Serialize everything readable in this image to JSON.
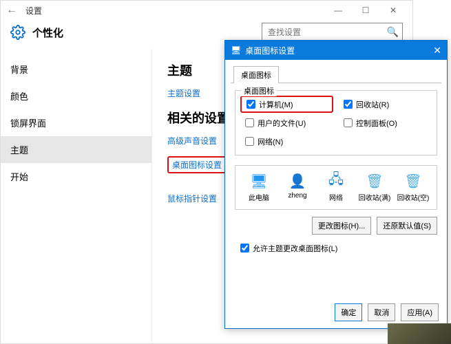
{
  "window": {
    "title": "设置"
  },
  "header": {
    "title": "个性化"
  },
  "search": {
    "placeholder": "查找设置"
  },
  "sidebar": {
    "items": [
      {
        "label": "背景"
      },
      {
        "label": "颜色"
      },
      {
        "label": "锁屏界面"
      },
      {
        "label": "主题"
      },
      {
        "label": "开始"
      }
    ],
    "selected_index": 3
  },
  "main": {
    "heading1": "主题",
    "link_theme_settings": "主题设置",
    "heading2": "相关的设置",
    "link_sound": "高级声音设置",
    "link_desktop_icons": "桌面图标设置",
    "link_mouse": "鼠标指针设置"
  },
  "dialog": {
    "title": "桌面图标设置",
    "tab": "桌面图标",
    "group_label": "桌面图标",
    "checks": {
      "computer": {
        "label": "计算机(M)",
        "checked": true
      },
      "recycle": {
        "label": "回收站(R)",
        "checked": true
      },
      "user_files": {
        "label": "用户的文件(U)",
        "checked": false
      },
      "control_panel": {
        "label": "控制面板(O)",
        "checked": false
      },
      "network": {
        "label": "网络(N)",
        "checked": false
      }
    },
    "icons": [
      {
        "name": "此电脑",
        "glyph": "🖥"
      },
      {
        "name": "zheng",
        "glyph": "👤"
      },
      {
        "name": "网络",
        "glyph": "🖧"
      },
      {
        "name": "回收站(满)",
        "glyph": "🗑"
      },
      {
        "name": "回收站(空)",
        "glyph": "🗑"
      }
    ],
    "btn_change": "更改图标(H)...",
    "btn_restore": "还原默认值(S)",
    "allow_theme": {
      "label": "允许主题更改桌面图标(L)",
      "checked": true
    },
    "btn_ok": "确定",
    "btn_cancel": "取消",
    "btn_apply": "应用(A)"
  }
}
